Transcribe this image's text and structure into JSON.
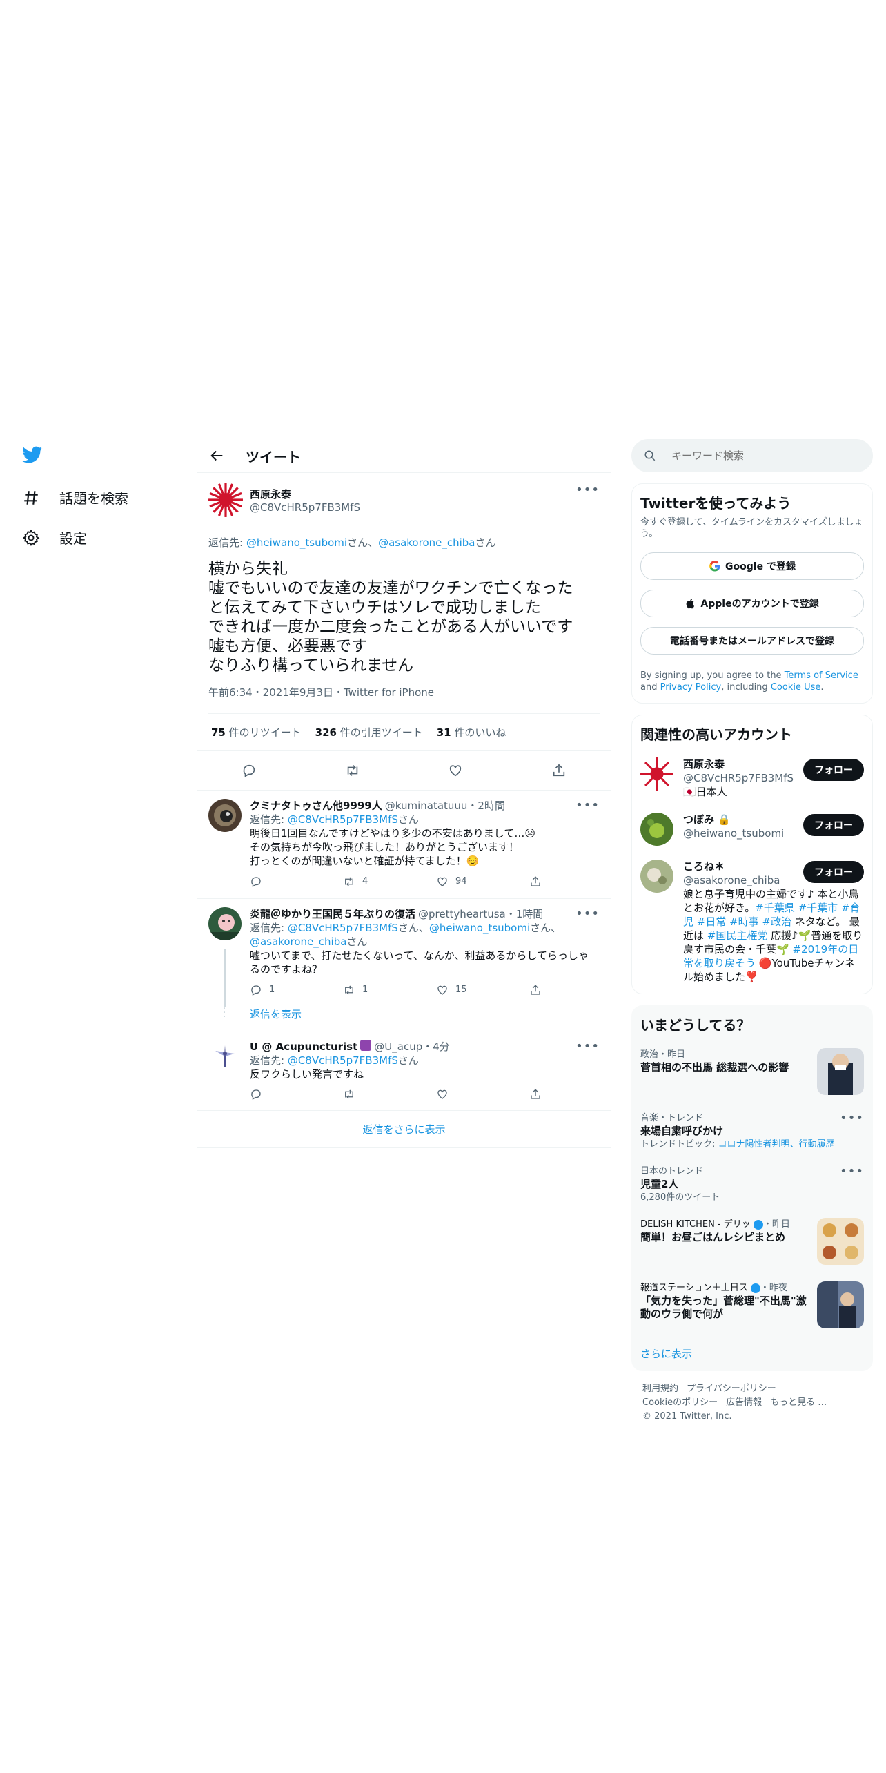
{
  "nav": {
    "explore_label": "話題を検索",
    "settings_label": "設定"
  },
  "header": {
    "title": "ツイート"
  },
  "focal": {
    "name": "西原永泰",
    "handle": "@C8VcHR5p7FB3MfS",
    "reply_prefix": "返信先: ",
    "reply_user1": "@heiwano_tsubomi",
    "reply_sep": "さん、",
    "reply_user2": "@asakorone_chiba",
    "reply_suffix": "さん",
    "text": "横から失礼\n嘘でもいいので友達の友達がワクチンで亡くなった\nと伝えてみて下さいウチはソレで成功しました\nできれば一度か二度会ったことがある人がいいです\n嘘も方便、必要悪です\nなりふり構っていられません",
    "timestamp": "午前6:34・2021年9月3日・Twitter for iPhone",
    "retweets_count": "75",
    "retweets_label": " 件のリツイート",
    "quotes_count": "326",
    "quotes_label": " 件の引用ツイート",
    "likes_count": "31",
    "likes_label": " 件のいいね"
  },
  "replies": [
    {
      "name": "クミナタトゥさん他9999人",
      "handle": "@kuminatatuuu・2時間",
      "reply_prefix": "返信先: ",
      "reply_user": "@C8VcHR5p7FB3MfS",
      "reply_suffix": "さん",
      "text": "明後日1回目なんですけどやはり多少の不安はありまして…😥\nその気持ちが今吹っ飛びました！ありがとうございます！\n打っとくのが間違いないと確証が持てました！☺️",
      "reply_count": "",
      "retweet_count": "4",
      "like_count": "94"
    },
    {
      "name": "炎龍＠ゆかり王国民５年ぶりの復活",
      "handle": "@prettyheartusa・1時間",
      "reply_prefix": "返信先: ",
      "reply_user": "@C8VcHR5p7FB3MfS",
      "reply_mid": "さん、",
      "reply_user2": "@heiwano_tsubomi",
      "reply_mid2": "さん、",
      "reply_user3": "@asakorone_chiba",
      "reply_suffix": "さん",
      "text": "嘘ついてまで、打たせたくないって、なんか、利益あるからしてらっしゃ\nるのですよね？",
      "reply_count": "1",
      "retweet_count": "1",
      "like_count": "15",
      "show_replies": "返信を表示"
    },
    {
      "name": "U @ Acupuncturist",
      "handle": "@U_acup・4分",
      "reply_prefix": "返信先: ",
      "reply_user": "@C8VcHR5p7FB3MfS",
      "reply_suffix": "さん",
      "text": "反ワクらしい発言ですね",
      "reply_count": "",
      "retweet_count": "",
      "like_count": ""
    }
  ],
  "more_replies": "返信をさらに表示",
  "search": {
    "placeholder": "キーワード検索"
  },
  "signup": {
    "title": "Twitterを使ってみよう",
    "subtitle": "今すぐ登録して、タイムラインをカスタマイズしましょう。",
    "google": "Google で登録",
    "apple": "Appleのアカウントで登録",
    "phone": "電話番号またはメールアドレスで登録",
    "terms_1": "By signing up, you agree to the ",
    "terms_link1": "Terms of Service",
    "terms_2": " and ",
    "terms_link2": "Privacy Policy",
    "terms_3": ", including ",
    "terms_link3": "Cookie Use",
    "terms_4": "."
  },
  "related": {
    "title": "関連性の高いアカウント",
    "follow": "フォロー",
    "accounts": [
      {
        "name": "西原永泰",
        "handle": "@C8VcHR5p7FB3MfS",
        "bio": "🇯🇵日本人"
      },
      {
        "name": "つぼみ 🔒",
        "handle": "@heiwano_tsubomi",
        "bio": ""
      },
      {
        "name": "ころね＊",
        "handle": "@asakorone_chiba",
        "bio_1": "娘と息子育児中の主婦です♪ 本と小鳥とお花が好き。",
        "bio_tags1": "#千葉県 #千葉市 #育児 #日常 #時事 #政治",
        "bio_2": " ネタなど。 最近は ",
        "bio_tag2": "#国民主権党",
        "bio_3": " 応援♪🌱普通を取り戻す市民の会・千葉🌱 ",
        "bio_tag3": "#2019年の日常を取り戻そう",
        "bio_4": " 🔴YouTubeチャンネル始めました❣️"
      }
    ]
  },
  "trends": {
    "title": "いまどうしてる？",
    "items": [
      {
        "ctx": "政治・昨日",
        "name": "菅首相の不出馬 総裁選への影響"
      },
      {
        "ctx": "音楽・トレンド",
        "name": "来場自粛呼びかけ",
        "sub_prefix": "トレンドトピック: ",
        "sub_link": "コロナ陽性者判明、行動履歴"
      },
      {
        "ctx": "日本のトレンド",
        "name": "児童2人",
        "sub": "6,280件のツイート"
      },
      {
        "ctx": "DELISH KITCHEN - デリッ",
        "ctx_time": "・昨日",
        "name": "簡単！お昼ごはんレシピまとめ"
      },
      {
        "ctx": "報道ステーション＋土日ス",
        "ctx_time": "・昨夜",
        "name": "「気力を失った」菅総理\"不出馬\"激動のウラ側で何が"
      }
    ],
    "show_more": "さらに表示"
  },
  "footer": {
    "terms": "利用規約",
    "privacy": "プライバシーポリシー",
    "cookie": "Cookieのポリシー",
    "ads": "広告情報",
    "more": "もっと見る …",
    "copyright": "© 2021 Twitter, Inc."
  },
  "colors": {
    "accent": "#1d9bf0",
    "link": "#1b95e0",
    "text": "#0f1419",
    "muted": "#536471",
    "border": "#eff3f4"
  },
  "icons": [
    "twitter-logo-icon",
    "hashtag-icon",
    "gear-icon",
    "back-arrow-icon",
    "search-icon",
    "reply-icon",
    "retweet-icon",
    "like-icon",
    "share-icon",
    "google-icon",
    "apple-icon",
    "lock-icon",
    "verified-icon"
  ]
}
